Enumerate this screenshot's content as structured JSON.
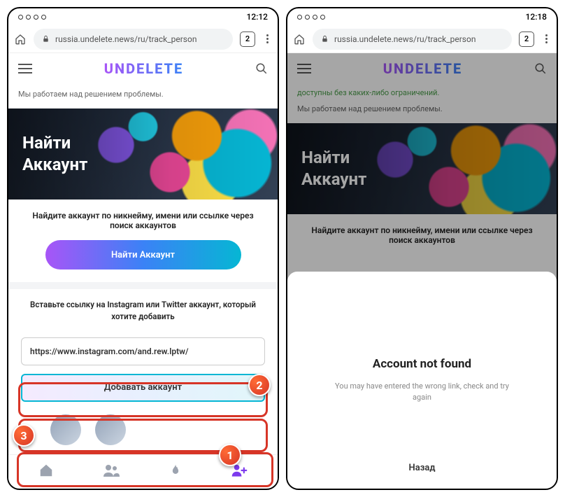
{
  "status": {
    "time_left": "12:12",
    "time_right": "12:18"
  },
  "browser": {
    "url": "russia.undelete.news/ru/track_person",
    "tabs": "2"
  },
  "site": {
    "logo": "UNDELETE",
    "green_note": "доступны без каких-либо ограничений.",
    "notice": "Мы работаем над решением проблемы.",
    "hero_line1": "Найти",
    "hero_line2": "Аккаунт",
    "subtext": "Найдите аккаунт по никнейму, имени или ссылке через поиск аккаунтов",
    "find_btn": "Найти Аккаунт",
    "paste_text": "Вставьте ссылку на Instagram или Twitter аккаунт, который хотите добавить",
    "input_value": "https://www.instagram.com/and.rew.lptw/",
    "add_btn": "Добавать аккаунт"
  },
  "sheet": {
    "title": "Account not found",
    "msg": "You may have entered the wrong link, check and try again",
    "back": "Назад"
  },
  "markers": {
    "m1": "1",
    "m2": "2",
    "m3": "3"
  }
}
